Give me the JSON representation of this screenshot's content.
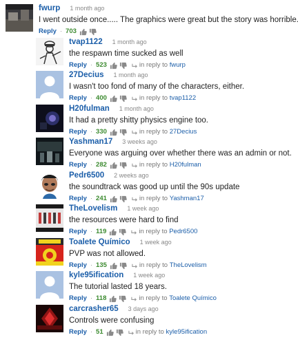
{
  "comments": [
    {
      "author": "fwurp",
      "time": "1 month ago",
      "text": "I went outside once..... The graphics were great but the story was horrible.",
      "likes": "703",
      "reply_label": "Reply",
      "in_reply_prefix": "",
      "in_reply_to": "",
      "avatar": "landscape-dark"
    },
    {
      "author": "tvap1122",
      "time": "1 month ago",
      "text": "the respawn time sucked as well",
      "likes": "523",
      "reply_label": "Reply",
      "in_reply_prefix": "in reply to",
      "in_reply_to": "fwurp",
      "avatar": "sketch-character"
    },
    {
      "author": "27Decius",
      "time": "1 month ago",
      "text": "I wasn't too fond of many of the characters, either.",
      "likes": "400",
      "reply_label": "Reply",
      "in_reply_prefix": "in reply to",
      "in_reply_to": "tvap1122",
      "avatar": "default-silhouette"
    },
    {
      "author": "H20fulman",
      "time": "1 month ago",
      "text": "It had a pretty shitty physics engine too.",
      "likes": "330",
      "reply_label": "Reply",
      "in_reply_prefix": "in reply to",
      "in_reply_to": "27Decius",
      "avatar": "dark-glow"
    },
    {
      "author": "Yashman17",
      "time": "3 weeks ago",
      "text": "Everyone was arguing over whether there was an admin or not.",
      "likes": "282",
      "reply_label": "Reply",
      "in_reply_prefix": "in reply to",
      "in_reply_to": "H20fulman",
      "avatar": "dark-scene"
    },
    {
      "author": "Pedr6500",
      "time": "2 weeks ago",
      "text": "the soundtrack was good up until the 90s update",
      "likes": "241",
      "reply_label": "Reply",
      "in_reply_prefix": "in reply to",
      "in_reply_to": "Yashman17",
      "avatar": "person-face"
    },
    {
      "author": "TheLovelism",
      "time": "1 week ago",
      "text": "the resources were hard to find",
      "likes": "119",
      "reply_label": "Reply",
      "in_reply_prefix": "in reply to",
      "in_reply_to": "Pedr6500",
      "avatar": "group-photo"
    },
    {
      "author": "Toalete Químico",
      "time": "1 week ago",
      "text": "PVP was not allowed.",
      "likes": "135",
      "reply_label": "Reply",
      "in_reply_prefix": "in reply to",
      "in_reply_to": "TheLovelism",
      "avatar": "red-yellow-logo"
    },
    {
      "author": "kyle95ification",
      "time": "1 week ago",
      "text": "The tutorial lasted 18 years.",
      "likes": "118",
      "reply_label": "Reply",
      "in_reply_prefix": "in reply to",
      "in_reply_to": "Toalete Químico",
      "avatar": "default-silhouette"
    },
    {
      "author": "carcrasher65",
      "time": "3 days ago",
      "text": "Controls were confusing",
      "likes": "51",
      "reply_label": "Reply",
      "in_reply_prefix": "in reply to",
      "in_reply_to": "kyle95ification",
      "avatar": "red-dark-art"
    }
  ],
  "colors": {
    "author": "#1b5ea9",
    "likes": "#3b8a2f",
    "default_avatar_bg": "#aac2e2"
  }
}
